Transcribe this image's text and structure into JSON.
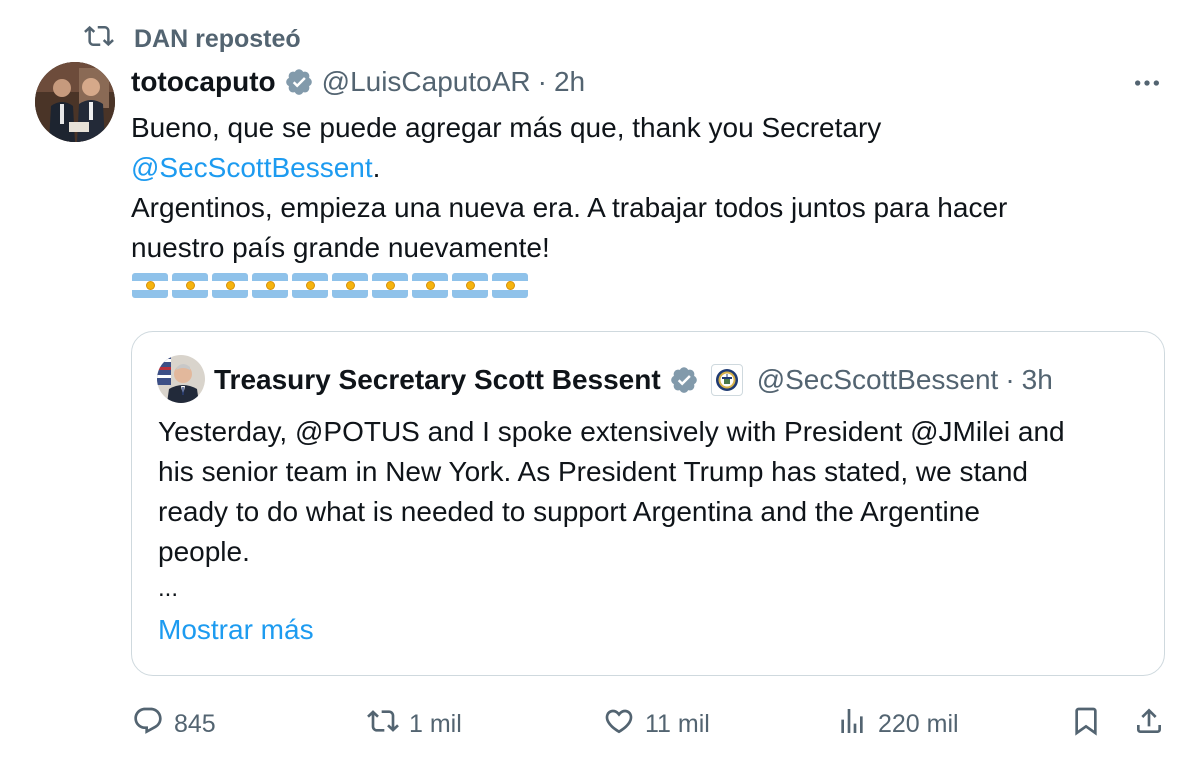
{
  "repost": {
    "label": "DAN reposteó",
    "icon": "repost-icon"
  },
  "tweet": {
    "author_name": "totocaputo",
    "handle": "@LuisCaputoAR",
    "separator": "·",
    "time": "2h",
    "text": {
      "line1": "Bueno, que se puede agregar más que, thank you Secretary",
      "mention": "@SecScottBessent",
      "after_mention": ".",
      "line3": "Argentinos, empieza una nueva era. A trabajar todos juntos para hacer",
      "line4": "nuestro país grande nuevamente!"
    },
    "flags": [
      "argentina-flag",
      "argentina-flag",
      "argentina-flag",
      "argentina-flag",
      "argentina-flag",
      "argentina-flag",
      "argentina-flag",
      "argentina-flag",
      "argentina-flag",
      "argentina-flag"
    ]
  },
  "quote": {
    "author_name": "Treasury Secretary Scott Bessent",
    "handle": "@SecScottBessent",
    "separator": "·",
    "time": "3h",
    "text_lines": [
      "Yesterday, @POTUS and I spoke extensively with President @JMilei and",
      "his senior team in New York.  As President Trump has stated, we stand",
      "ready to do what is needed to support Argentina and the Argentine",
      "people."
    ],
    "ellipsis": "...",
    "show_more": "Mostrar más"
  },
  "actions": {
    "replies": "845",
    "reposts": "1 mil",
    "likes": "11 mil",
    "views": "220 mil"
  },
  "colors": {
    "text": "#0f1419",
    "secondary": "#536471",
    "link": "#1d9bf0",
    "border": "#cfd9de",
    "verified": "#829aab"
  }
}
